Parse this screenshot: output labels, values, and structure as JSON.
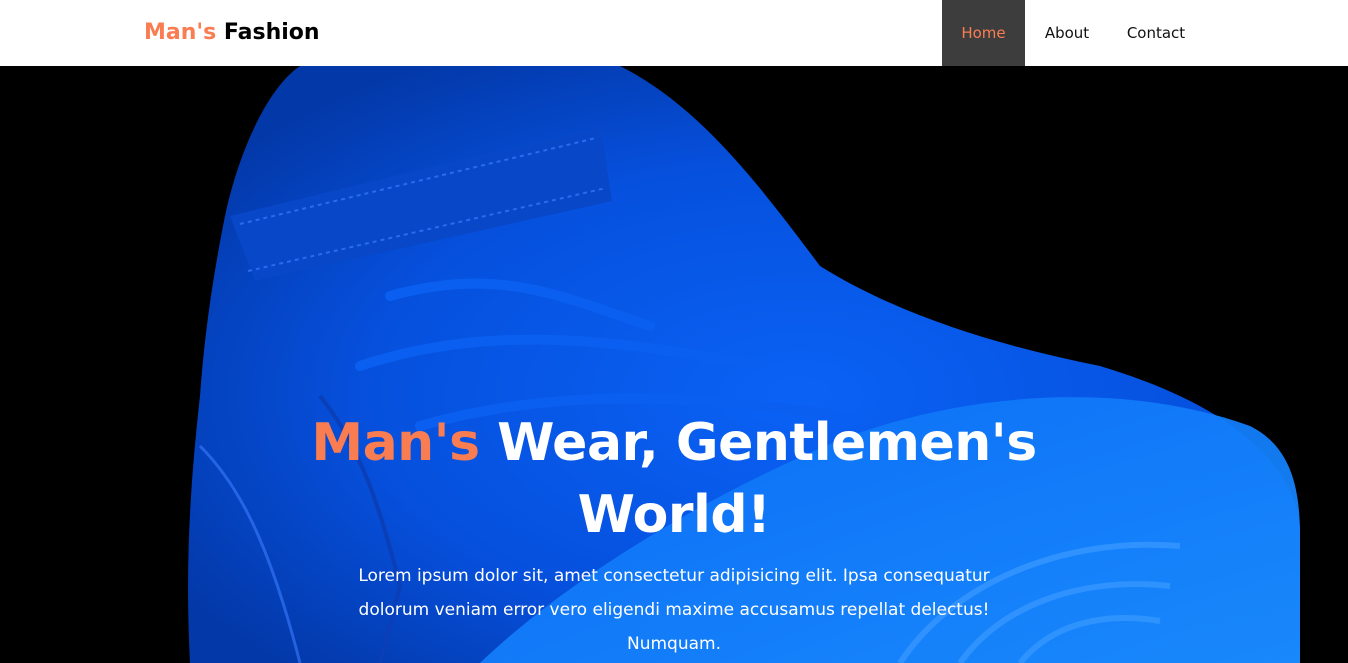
{
  "brand": {
    "accent": "Man's",
    "rest": " Fashion"
  },
  "nav": {
    "home": "Home",
    "about": "About",
    "contact": "Contact"
  },
  "hero": {
    "title_accent": "Man's",
    "title_rest": " Wear, Gentlemen's World!",
    "text": "Lorem ipsum dolor sit, amet consectetur adipisicing elit. Ipsa consequatur dolorum veniam error vero eligendi maxime accusamus repellat delectus! Numquam."
  },
  "colors": {
    "accent": "#fa7d52",
    "nav_active_bg": "#3d3d3d",
    "hero_bg": "#000000",
    "shoe": "#0a5cf0"
  },
  "icons": {
    "hero_image": "blue-sneaker"
  }
}
